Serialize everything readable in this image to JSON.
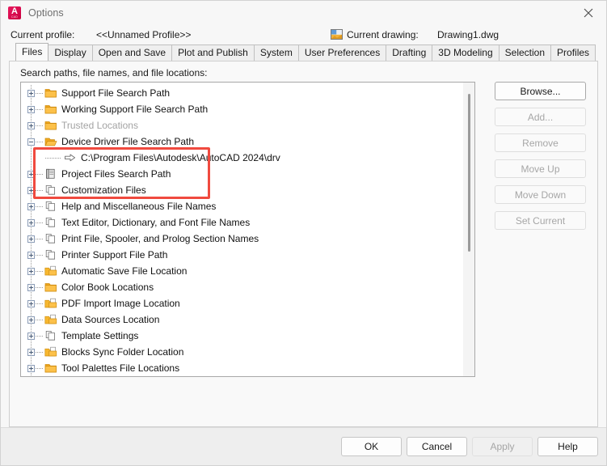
{
  "window": {
    "title": "Options",
    "app_icon": "autocad-a-icon",
    "app_icon_letter": "A",
    "app_icon_subtext": "CAD",
    "app_icon_color": "#e8195e",
    "close_icon": "close-icon"
  },
  "profile": {
    "label": "Current profile:",
    "value": "<<Unnamed Profile>>",
    "drawing_icon": "drawing-file-icon",
    "drawing_label": "Current drawing:",
    "drawing_value": "Drawing1.dwg"
  },
  "tabs": [
    {
      "label": "Files",
      "active": true
    },
    {
      "label": "Display",
      "active": false
    },
    {
      "label": "Open and Save",
      "active": false
    },
    {
      "label": "Plot and Publish",
      "active": false
    },
    {
      "label": "System",
      "active": false
    },
    {
      "label": "User Preferences",
      "active": false
    },
    {
      "label": "Drafting",
      "active": false
    },
    {
      "label": "3D Modeling",
      "active": false
    },
    {
      "label": "Selection",
      "active": false
    },
    {
      "label": "Profiles",
      "active": false
    }
  ],
  "files_tab": {
    "group_label": "Search paths, file names, and file locations:",
    "tree": [
      {
        "label": "Support File Search Path",
        "icon": "folder-closed-icon",
        "expander": "plus",
        "indent": 0,
        "dim": false
      },
      {
        "label": "Working Support File Search Path",
        "icon": "folder-closed-icon",
        "expander": "plus",
        "indent": 0,
        "dim": false
      },
      {
        "label": "Trusted Locations",
        "icon": "folder-closed-icon",
        "expander": "plus",
        "indent": 0,
        "dim": true
      },
      {
        "label": "Device Driver File Search Path",
        "icon": "folder-open-icon",
        "expander": "minus",
        "indent": 0,
        "dim": false
      },
      {
        "label": "C:\\Program Files\\Autodesk\\AutoCAD 2024\\drv",
        "icon": "arrow-right-icon",
        "expander": "none",
        "indent": 1,
        "dim": false
      },
      {
        "label": "Project Files Search Path",
        "icon": "binder-icon",
        "expander": "plus",
        "indent": 0,
        "dim": false
      },
      {
        "label": "Customization Files",
        "icon": "pages-icon",
        "expander": "plus",
        "indent": 0,
        "dim": false
      },
      {
        "label": "Help and Miscellaneous File Names",
        "icon": "pages-icon",
        "expander": "plus",
        "indent": 0,
        "dim": false
      },
      {
        "label": "Text Editor, Dictionary, and Font File Names",
        "icon": "pages-icon",
        "expander": "plus",
        "indent": 0,
        "dim": false
      },
      {
        "label": "Print File, Spooler, and Prolog Section Names",
        "icon": "pages-icon",
        "expander": "plus",
        "indent": 0,
        "dim": false
      },
      {
        "label": "Printer Support File Path",
        "icon": "pages-icon",
        "expander": "plus",
        "indent": 0,
        "dim": false
      },
      {
        "label": "Automatic Save File Location",
        "icon": "folder-page-icon",
        "expander": "plus",
        "indent": 0,
        "dim": false
      },
      {
        "label": "Color Book Locations",
        "icon": "folder-closed-icon",
        "expander": "plus",
        "indent": 0,
        "dim": false
      },
      {
        "label": "PDF Import Image Location",
        "icon": "folder-page-icon",
        "expander": "plus",
        "indent": 0,
        "dim": false
      },
      {
        "label": "Data Sources Location",
        "icon": "folder-page-icon",
        "expander": "plus",
        "indent": 0,
        "dim": false
      },
      {
        "label": "Template Settings",
        "icon": "pages-icon",
        "expander": "plus",
        "indent": 0,
        "dim": false
      },
      {
        "label": "Blocks Sync Folder Location",
        "icon": "folder-page-icon",
        "expander": "plus",
        "indent": 0,
        "dim": false
      },
      {
        "label": "Tool Palettes File Locations",
        "icon": "folder-closed-icon",
        "expander": "plus",
        "indent": 0,
        "dim": false
      }
    ],
    "side_buttons": [
      {
        "label": "Browse...",
        "enabled": true,
        "default": true
      },
      {
        "label": "Add...",
        "enabled": false,
        "default": false
      },
      {
        "label": "Remove",
        "enabled": false,
        "default": false
      },
      {
        "label": "Move Up",
        "enabled": false,
        "default": false
      },
      {
        "label": "Move Down",
        "enabled": false,
        "default": false
      },
      {
        "label": "Set Current",
        "enabled": false,
        "default": false
      }
    ]
  },
  "annotation": {
    "highlight_color": "#f04a3f",
    "highlights": [
      "Support File Search Path",
      "Working Support File Search Path",
      "Trusted Locations"
    ]
  },
  "footer": {
    "ok": "OK",
    "cancel": "Cancel",
    "apply": "Apply",
    "apply_enabled": false,
    "help": "Help"
  }
}
